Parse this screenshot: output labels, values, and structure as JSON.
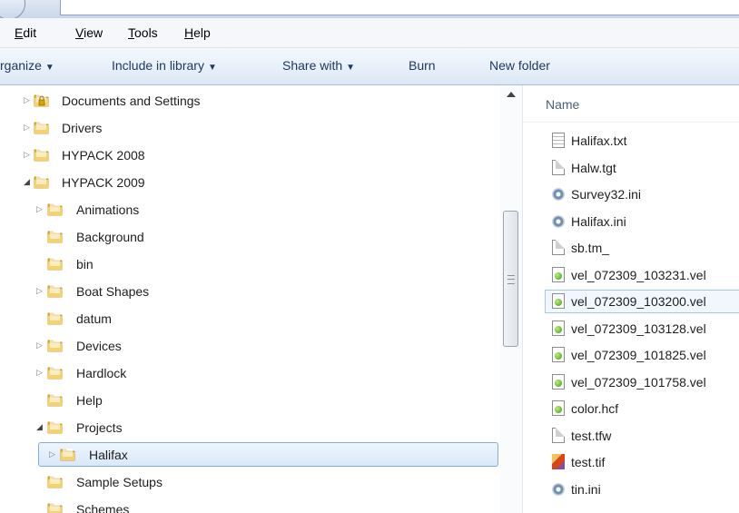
{
  "menu": {
    "items": [
      {
        "key": "edit",
        "label": "Edit",
        "mnemonic": "E",
        "rest": "dit"
      },
      {
        "key": "view",
        "label": "View",
        "mnemonic": "V",
        "rest": "iew"
      },
      {
        "key": "tools",
        "label": "Tools",
        "mnemonic": "T",
        "rest": "ools"
      },
      {
        "key": "help",
        "label": "Help",
        "mnemonic": "H",
        "rest": "elp"
      }
    ]
  },
  "toolbar": {
    "organize": "rganize",
    "include_in_library": "Include in library",
    "share_with": "Share with",
    "burn": "Burn",
    "new_folder": "New folder",
    "dropdown_arrow": "▼"
  },
  "navigation_tree": [
    {
      "label": "Documents and Settings",
      "level": 0,
      "expander": "collapsed",
      "icon": "locked-folder-icon"
    },
    {
      "label": "Drivers",
      "level": 0,
      "expander": "collapsed",
      "icon": "folder-icon"
    },
    {
      "label": "HYPACK 2008",
      "level": 0,
      "expander": "collapsed",
      "icon": "folder-icon"
    },
    {
      "label": "HYPACK 2009",
      "level": 0,
      "expander": "expanded",
      "icon": "folder-icon"
    },
    {
      "label": "Animations",
      "level": 1,
      "expander": "collapsed",
      "icon": "folder-icon"
    },
    {
      "label": "Background",
      "level": 1,
      "expander": "none",
      "icon": "folder-icon"
    },
    {
      "label": "bin",
      "level": 1,
      "expander": "none",
      "icon": "folder-icon"
    },
    {
      "label": "Boat Shapes",
      "level": 1,
      "expander": "collapsed",
      "icon": "folder-icon"
    },
    {
      "label": "datum",
      "level": 1,
      "expander": "none",
      "icon": "folder-icon"
    },
    {
      "label": "Devices",
      "level": 1,
      "expander": "collapsed",
      "icon": "folder-icon"
    },
    {
      "label": "Hardlock",
      "level": 1,
      "expander": "collapsed",
      "icon": "folder-icon"
    },
    {
      "label": "Help",
      "level": 1,
      "expander": "none",
      "icon": "folder-icon"
    },
    {
      "label": "Projects",
      "level": 1,
      "expander": "expanded",
      "icon": "folder-icon"
    },
    {
      "label": "Halifax",
      "level": 2,
      "expander": "collapsed",
      "icon": "folder-icon",
      "selected": true
    },
    {
      "label": "Sample Setups",
      "level": 1,
      "expander": "none",
      "icon": "folder-icon"
    },
    {
      "label": "Schemes",
      "level": 1,
      "expander": "none",
      "icon": "folder-icon"
    }
  ],
  "file_list": {
    "column_header": "Name",
    "files": [
      {
        "name": "Halifax.txt",
        "icon": "text-file-icon"
      },
      {
        "name": "Halw.tgt",
        "icon": "blank-file-icon"
      },
      {
        "name": "Survey32.ini",
        "icon": "settings-file-icon"
      },
      {
        "name": "Halifax.ini",
        "icon": "settings-file-icon"
      },
      {
        "name": "sb.tm_",
        "icon": "blank-file-icon"
      },
      {
        "name": "vel_072309_103231.vel",
        "icon": "hypack-file-icon"
      },
      {
        "name": "vel_072309_103200.vel",
        "icon": "hypack-file-icon",
        "selected": true
      },
      {
        "name": "vel_072309_103128.vel",
        "icon": "hypack-file-icon"
      },
      {
        "name": "vel_072309_101825.vel",
        "icon": "hypack-file-icon"
      },
      {
        "name": "vel_072309_101758.vel",
        "icon": "hypack-file-icon"
      },
      {
        "name": "color.hcf",
        "icon": "hypack-file-icon"
      },
      {
        "name": "test.tfw",
        "icon": "blank-file-icon"
      },
      {
        "name": "test.tif",
        "icon": "image-file-icon"
      },
      {
        "name": "tin.ini",
        "icon": "settings-file-icon"
      }
    ]
  },
  "colors": {
    "folder": "#e8b93c",
    "selection_border": "#84acdd",
    "toolbar_text": "#1e3962"
  }
}
